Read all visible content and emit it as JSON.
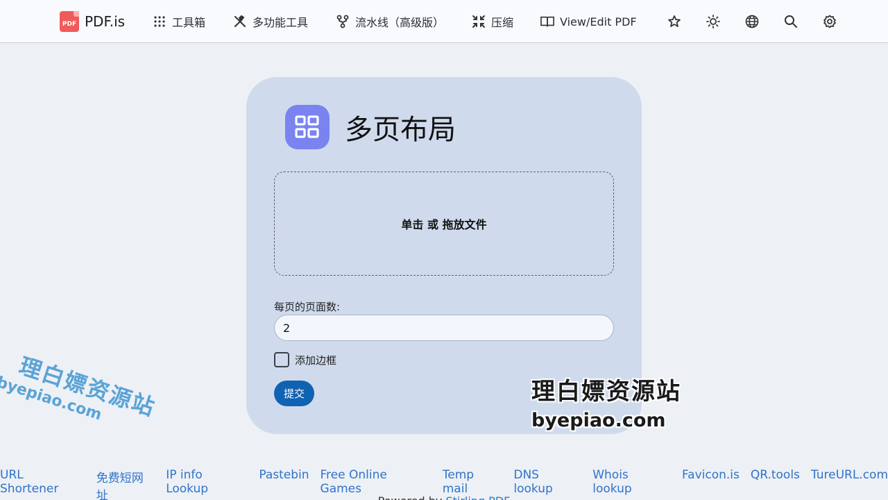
{
  "nav": {
    "brand": "PDF.is",
    "brand_logo_text": "PDF",
    "items": [
      {
        "label": "工具箱",
        "icon": "grid-dots-icon"
      },
      {
        "label": "多功能工具",
        "icon": "tools-icon"
      },
      {
        "label": "流水线（高级版）",
        "icon": "pipeline-icon"
      },
      {
        "label": "压缩",
        "icon": "compress-icon"
      },
      {
        "label": "View/Edit PDF",
        "icon": "book-open-icon"
      }
    ],
    "icon_buttons": [
      "star-icon",
      "sun-icon",
      "globe-icon",
      "search-icon",
      "gear-icon"
    ]
  },
  "tool": {
    "title": "多页布局",
    "icon": "layout-grid-icon",
    "icon_color": "#7a83f0",
    "dropzone_text": "单击 或 拖放文件",
    "pages_label": "每页的页面数:",
    "pages_value": "2",
    "border_label": "添加边框",
    "submit_label": "提交"
  },
  "watermark": {
    "cn": "理白嫖资源站",
    "en": "byepiao.com"
  },
  "footer": {
    "links": [
      "URL Shortener",
      "免费短网址",
      "IP info Lookup",
      "Pastebin",
      "Free Online Games",
      "Temp mail",
      "DNS lookup",
      "Whois lookup",
      "Favicon.is",
      "QR.tools",
      "TureURL.com"
    ],
    "powered_prefix": "Powered by",
    "powered_link": "Stirling PDF"
  },
  "colors": {
    "accent": "#1062b2",
    "link": "#2f73c9",
    "card": "#cfdbec",
    "background": "#edf0f5"
  }
}
